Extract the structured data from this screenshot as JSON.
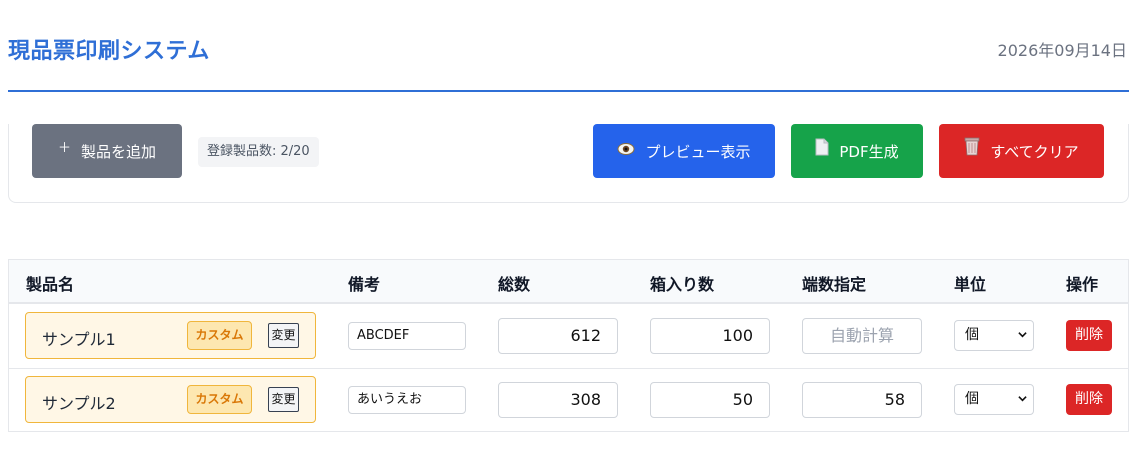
{
  "header": {
    "title": "現品票印刷システム",
    "date": "2026年09月14日"
  },
  "toolbar": {
    "add_label": "製品を追加",
    "add_icon": "plus-icon",
    "count_label": "登録製品数: 2/20",
    "preview_label": "プレビュー表示",
    "preview_icon": "eye-icon",
    "pdf_label": "PDF生成",
    "pdf_icon": "document-icon",
    "clear_label": "すべてクリア",
    "clear_icon": "trash-icon",
    "colors": {
      "add": "#6b7280",
      "preview": "#2563eb",
      "pdf": "#16a34a",
      "clear": "#dc2626"
    }
  },
  "table": {
    "columns": [
      "製品名",
      "備考",
      "総数",
      "箱入り数",
      "端数指定",
      "単位",
      "操作"
    ],
    "rows": [
      {
        "name": "サンプル1",
        "badge": "カスタム",
        "change": "変更",
        "note": "ABCDEF",
        "total": "612",
        "per_box": "100",
        "remainder": "",
        "remainder_placeholder": "自動計算",
        "unit": "個",
        "delete": "削除"
      },
      {
        "name": "サンプル2",
        "badge": "カスタム",
        "change": "変更",
        "note": "あいうえお",
        "total": "308",
        "per_box": "50",
        "remainder": "58",
        "remainder_placeholder": "",
        "unit": "個",
        "delete": "削除"
      }
    ]
  }
}
